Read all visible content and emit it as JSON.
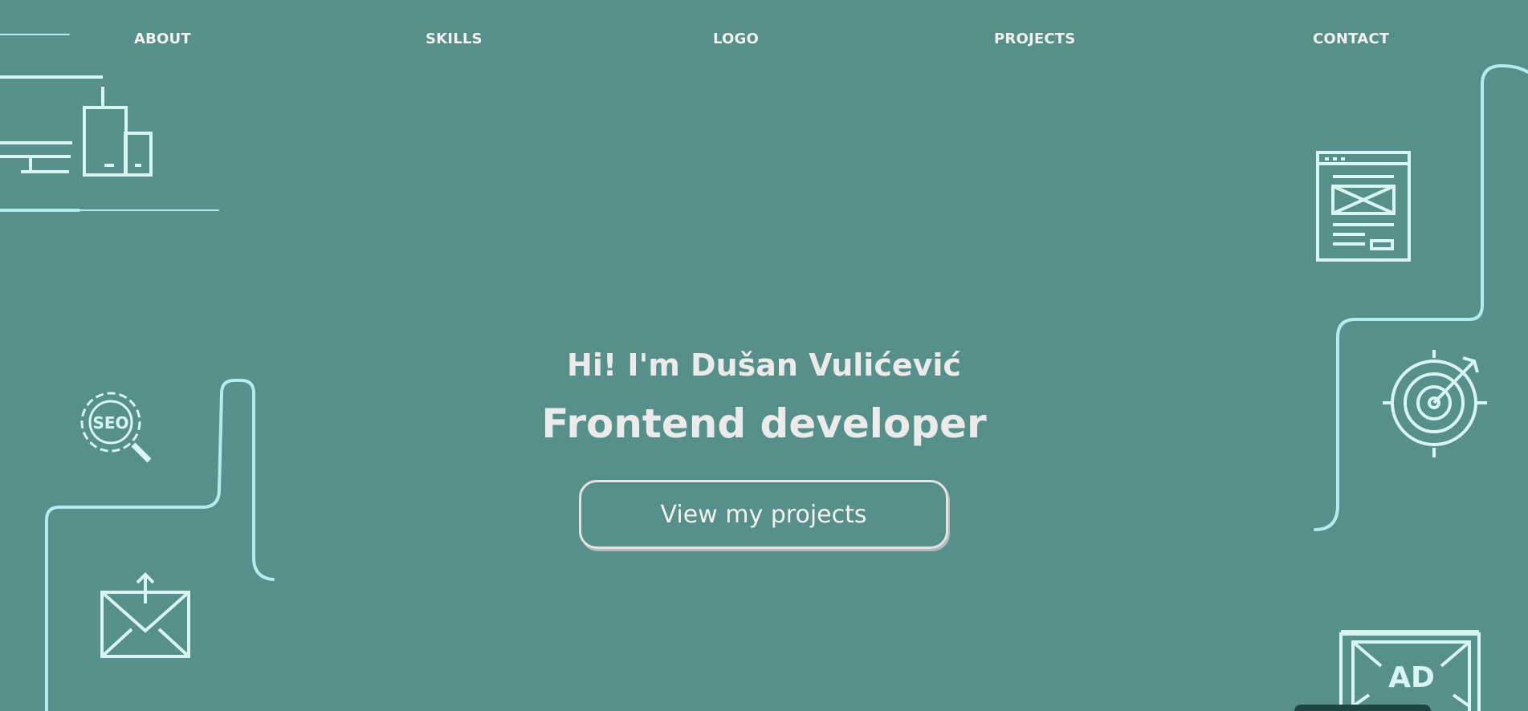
{
  "nav": {
    "items": [
      "ABOUT",
      "SKILLS",
      "LOGO",
      "PROJECTS",
      "CONTACT"
    ]
  },
  "hero": {
    "greeting": "Hi! I'm Dušan Vulićević",
    "role": "Frontend developer",
    "cta_label": "View my projects"
  },
  "icons": {
    "devices": "devices-icon",
    "seo": "seo-gear-icon",
    "mail": "mail-send-icon",
    "webpage": "webpage-layout-icon",
    "target": "target-icon",
    "ad": "ad-banner-icon",
    "seo_text": "SEO",
    "ad_text": "AD"
  },
  "colors": {
    "background": "#578f8a",
    "line_accent": "#b3ecec",
    "text": "#ebebeb",
    "footer_tab": "#1f4542"
  }
}
